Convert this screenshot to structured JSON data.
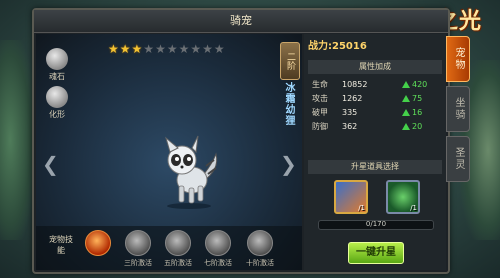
{
  "window": {
    "title": "骑宠"
  },
  "logo": {
    "text": "王者之光"
  },
  "left": {
    "stars": {
      "filled": 3,
      "total": 10
    },
    "side_buttons": [
      {
        "label": "魂石",
        "icon": "soul-stone-icon"
      },
      {
        "label": "化形",
        "icon": "transform-icon"
      }
    ],
    "rank": "二阶",
    "pet_name": "冰霜幼狸",
    "skills_label": "宠物技能",
    "skills": [
      {
        "label": "",
        "icon": "fire-skill-icon"
      },
      {
        "label": "三阶激活",
        "icon": "skill-locked-icon"
      },
      {
        "label": "五阶激活",
        "icon": "skill-locked-icon"
      },
      {
        "label": "七阶激活",
        "icon": "skill-locked-icon"
      },
      {
        "label": "十阶激活",
        "icon": "skill-locked-icon"
      }
    ]
  },
  "right": {
    "power_label": "战力:",
    "power_value": "25016",
    "attr_title": "属性加成",
    "attrs": [
      {
        "name": "生命",
        "value": "10852",
        "add": "420"
      },
      {
        "name": "攻击",
        "value": "1262",
        "add": "75"
      },
      {
        "name": "破甲",
        "value": "335",
        "add": "16"
      },
      {
        "name": "防御",
        "value": "362",
        "add": "20"
      }
    ],
    "upgrade_title": "升星道具选择",
    "items": [
      {
        "count": "/1",
        "icon": "star-card-icon"
      },
      {
        "count": "/1",
        "icon": "green-orb-icon"
      }
    ],
    "progress": {
      "text": "0/170",
      "fraction": 0.0
    },
    "upgrade_button": "一键升星"
  },
  "tabs": [
    {
      "label": "宠物"
    },
    {
      "label": "坐骑"
    },
    {
      "label": "圣灵"
    }
  ],
  "colors": {
    "accent": "#e06a14",
    "gold": "#f2c233",
    "green": "#5fe05a"
  }
}
